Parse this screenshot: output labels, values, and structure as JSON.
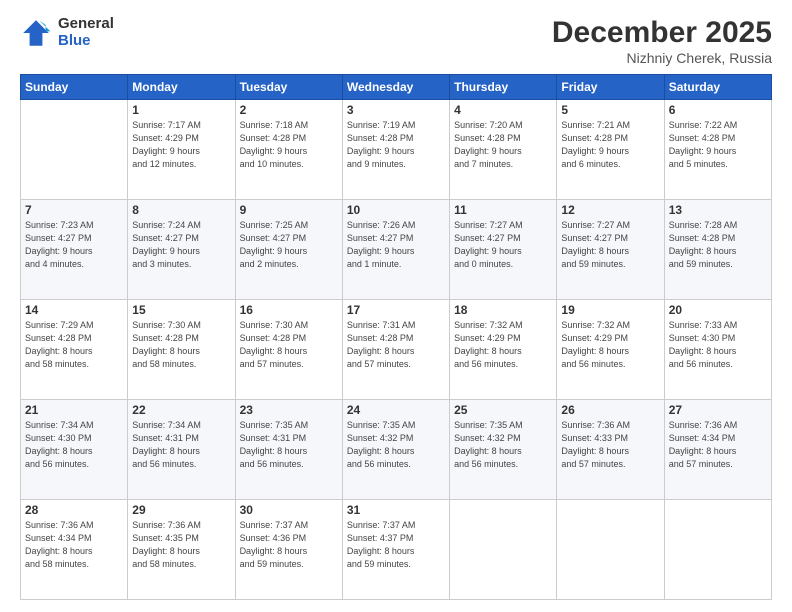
{
  "logo": {
    "general": "General",
    "blue": "Blue"
  },
  "header": {
    "month": "December 2025",
    "location": "Nizhniy Cherek, Russia"
  },
  "days_of_week": [
    "Sunday",
    "Monday",
    "Tuesday",
    "Wednesday",
    "Thursday",
    "Friday",
    "Saturday"
  ],
  "weeks": [
    [
      {
        "day": "",
        "info": ""
      },
      {
        "day": "1",
        "info": "Sunrise: 7:17 AM\nSunset: 4:29 PM\nDaylight: 9 hours\nand 12 minutes."
      },
      {
        "day": "2",
        "info": "Sunrise: 7:18 AM\nSunset: 4:28 PM\nDaylight: 9 hours\nand 10 minutes."
      },
      {
        "day": "3",
        "info": "Sunrise: 7:19 AM\nSunset: 4:28 PM\nDaylight: 9 hours\nand 9 minutes."
      },
      {
        "day": "4",
        "info": "Sunrise: 7:20 AM\nSunset: 4:28 PM\nDaylight: 9 hours\nand 7 minutes."
      },
      {
        "day": "5",
        "info": "Sunrise: 7:21 AM\nSunset: 4:28 PM\nDaylight: 9 hours\nand 6 minutes."
      },
      {
        "day": "6",
        "info": "Sunrise: 7:22 AM\nSunset: 4:28 PM\nDaylight: 9 hours\nand 5 minutes."
      }
    ],
    [
      {
        "day": "7",
        "info": "Sunrise: 7:23 AM\nSunset: 4:27 PM\nDaylight: 9 hours\nand 4 minutes."
      },
      {
        "day": "8",
        "info": "Sunrise: 7:24 AM\nSunset: 4:27 PM\nDaylight: 9 hours\nand 3 minutes."
      },
      {
        "day": "9",
        "info": "Sunrise: 7:25 AM\nSunset: 4:27 PM\nDaylight: 9 hours\nand 2 minutes."
      },
      {
        "day": "10",
        "info": "Sunrise: 7:26 AM\nSunset: 4:27 PM\nDaylight: 9 hours\nand 1 minute."
      },
      {
        "day": "11",
        "info": "Sunrise: 7:27 AM\nSunset: 4:27 PM\nDaylight: 9 hours\nand 0 minutes."
      },
      {
        "day": "12",
        "info": "Sunrise: 7:27 AM\nSunset: 4:27 PM\nDaylight: 8 hours\nand 59 minutes."
      },
      {
        "day": "13",
        "info": "Sunrise: 7:28 AM\nSunset: 4:28 PM\nDaylight: 8 hours\nand 59 minutes."
      }
    ],
    [
      {
        "day": "14",
        "info": "Sunrise: 7:29 AM\nSunset: 4:28 PM\nDaylight: 8 hours\nand 58 minutes."
      },
      {
        "day": "15",
        "info": "Sunrise: 7:30 AM\nSunset: 4:28 PM\nDaylight: 8 hours\nand 58 minutes."
      },
      {
        "day": "16",
        "info": "Sunrise: 7:30 AM\nSunset: 4:28 PM\nDaylight: 8 hours\nand 57 minutes."
      },
      {
        "day": "17",
        "info": "Sunrise: 7:31 AM\nSunset: 4:28 PM\nDaylight: 8 hours\nand 57 minutes."
      },
      {
        "day": "18",
        "info": "Sunrise: 7:32 AM\nSunset: 4:29 PM\nDaylight: 8 hours\nand 56 minutes."
      },
      {
        "day": "19",
        "info": "Sunrise: 7:32 AM\nSunset: 4:29 PM\nDaylight: 8 hours\nand 56 minutes."
      },
      {
        "day": "20",
        "info": "Sunrise: 7:33 AM\nSunset: 4:30 PM\nDaylight: 8 hours\nand 56 minutes."
      }
    ],
    [
      {
        "day": "21",
        "info": "Sunrise: 7:34 AM\nSunset: 4:30 PM\nDaylight: 8 hours\nand 56 minutes."
      },
      {
        "day": "22",
        "info": "Sunrise: 7:34 AM\nSunset: 4:31 PM\nDaylight: 8 hours\nand 56 minutes."
      },
      {
        "day": "23",
        "info": "Sunrise: 7:35 AM\nSunset: 4:31 PM\nDaylight: 8 hours\nand 56 minutes."
      },
      {
        "day": "24",
        "info": "Sunrise: 7:35 AM\nSunset: 4:32 PM\nDaylight: 8 hours\nand 56 minutes."
      },
      {
        "day": "25",
        "info": "Sunrise: 7:35 AM\nSunset: 4:32 PM\nDaylight: 8 hours\nand 56 minutes."
      },
      {
        "day": "26",
        "info": "Sunrise: 7:36 AM\nSunset: 4:33 PM\nDaylight: 8 hours\nand 57 minutes."
      },
      {
        "day": "27",
        "info": "Sunrise: 7:36 AM\nSunset: 4:34 PM\nDaylight: 8 hours\nand 57 minutes."
      }
    ],
    [
      {
        "day": "28",
        "info": "Sunrise: 7:36 AM\nSunset: 4:34 PM\nDaylight: 8 hours\nand 58 minutes."
      },
      {
        "day": "29",
        "info": "Sunrise: 7:36 AM\nSunset: 4:35 PM\nDaylight: 8 hours\nand 58 minutes."
      },
      {
        "day": "30",
        "info": "Sunrise: 7:37 AM\nSunset: 4:36 PM\nDaylight: 8 hours\nand 59 minutes."
      },
      {
        "day": "31",
        "info": "Sunrise: 7:37 AM\nSunset: 4:37 PM\nDaylight: 8 hours\nand 59 minutes."
      },
      {
        "day": "",
        "info": ""
      },
      {
        "day": "",
        "info": ""
      },
      {
        "day": "",
        "info": ""
      }
    ]
  ]
}
